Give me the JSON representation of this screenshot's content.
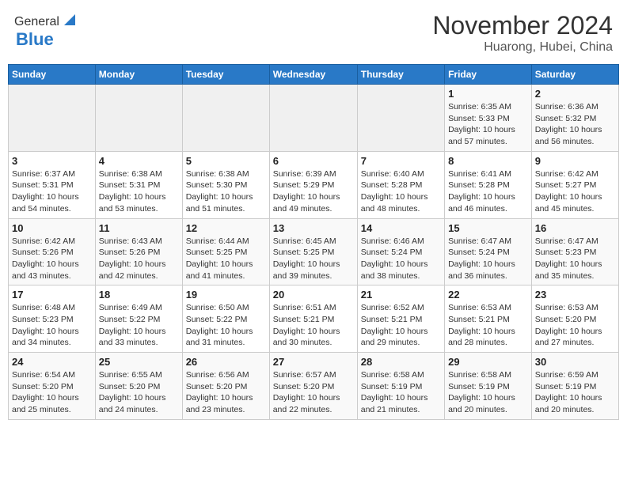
{
  "header": {
    "logo_general": "General",
    "logo_blue": "Blue",
    "title": "November 2024",
    "subtitle": "Huarong, Hubei, China"
  },
  "days_of_week": [
    "Sunday",
    "Monday",
    "Tuesday",
    "Wednesday",
    "Thursday",
    "Friday",
    "Saturday"
  ],
  "weeks": [
    [
      {
        "day": "",
        "info": ""
      },
      {
        "day": "",
        "info": ""
      },
      {
        "day": "",
        "info": ""
      },
      {
        "day": "",
        "info": ""
      },
      {
        "day": "",
        "info": ""
      },
      {
        "day": "1",
        "info": "Sunrise: 6:35 AM\nSunset: 5:33 PM\nDaylight: 10 hours\nand 57 minutes."
      },
      {
        "day": "2",
        "info": "Sunrise: 6:36 AM\nSunset: 5:32 PM\nDaylight: 10 hours\nand 56 minutes."
      }
    ],
    [
      {
        "day": "3",
        "info": "Sunrise: 6:37 AM\nSunset: 5:31 PM\nDaylight: 10 hours\nand 54 minutes."
      },
      {
        "day": "4",
        "info": "Sunrise: 6:38 AM\nSunset: 5:31 PM\nDaylight: 10 hours\nand 53 minutes."
      },
      {
        "day": "5",
        "info": "Sunrise: 6:38 AM\nSunset: 5:30 PM\nDaylight: 10 hours\nand 51 minutes."
      },
      {
        "day": "6",
        "info": "Sunrise: 6:39 AM\nSunset: 5:29 PM\nDaylight: 10 hours\nand 49 minutes."
      },
      {
        "day": "7",
        "info": "Sunrise: 6:40 AM\nSunset: 5:28 PM\nDaylight: 10 hours\nand 48 minutes."
      },
      {
        "day": "8",
        "info": "Sunrise: 6:41 AM\nSunset: 5:28 PM\nDaylight: 10 hours\nand 46 minutes."
      },
      {
        "day": "9",
        "info": "Sunrise: 6:42 AM\nSunset: 5:27 PM\nDaylight: 10 hours\nand 45 minutes."
      }
    ],
    [
      {
        "day": "10",
        "info": "Sunrise: 6:42 AM\nSunset: 5:26 PM\nDaylight: 10 hours\nand 43 minutes."
      },
      {
        "day": "11",
        "info": "Sunrise: 6:43 AM\nSunset: 5:26 PM\nDaylight: 10 hours\nand 42 minutes."
      },
      {
        "day": "12",
        "info": "Sunrise: 6:44 AM\nSunset: 5:25 PM\nDaylight: 10 hours\nand 41 minutes."
      },
      {
        "day": "13",
        "info": "Sunrise: 6:45 AM\nSunset: 5:25 PM\nDaylight: 10 hours\nand 39 minutes."
      },
      {
        "day": "14",
        "info": "Sunrise: 6:46 AM\nSunset: 5:24 PM\nDaylight: 10 hours\nand 38 minutes."
      },
      {
        "day": "15",
        "info": "Sunrise: 6:47 AM\nSunset: 5:24 PM\nDaylight: 10 hours\nand 36 minutes."
      },
      {
        "day": "16",
        "info": "Sunrise: 6:47 AM\nSunset: 5:23 PM\nDaylight: 10 hours\nand 35 minutes."
      }
    ],
    [
      {
        "day": "17",
        "info": "Sunrise: 6:48 AM\nSunset: 5:23 PM\nDaylight: 10 hours\nand 34 minutes."
      },
      {
        "day": "18",
        "info": "Sunrise: 6:49 AM\nSunset: 5:22 PM\nDaylight: 10 hours\nand 33 minutes."
      },
      {
        "day": "19",
        "info": "Sunrise: 6:50 AM\nSunset: 5:22 PM\nDaylight: 10 hours\nand 31 minutes."
      },
      {
        "day": "20",
        "info": "Sunrise: 6:51 AM\nSunset: 5:21 PM\nDaylight: 10 hours\nand 30 minutes."
      },
      {
        "day": "21",
        "info": "Sunrise: 6:52 AM\nSunset: 5:21 PM\nDaylight: 10 hours\nand 29 minutes."
      },
      {
        "day": "22",
        "info": "Sunrise: 6:53 AM\nSunset: 5:21 PM\nDaylight: 10 hours\nand 28 minutes."
      },
      {
        "day": "23",
        "info": "Sunrise: 6:53 AM\nSunset: 5:20 PM\nDaylight: 10 hours\nand 27 minutes."
      }
    ],
    [
      {
        "day": "24",
        "info": "Sunrise: 6:54 AM\nSunset: 5:20 PM\nDaylight: 10 hours\nand 25 minutes."
      },
      {
        "day": "25",
        "info": "Sunrise: 6:55 AM\nSunset: 5:20 PM\nDaylight: 10 hours\nand 24 minutes."
      },
      {
        "day": "26",
        "info": "Sunrise: 6:56 AM\nSunset: 5:20 PM\nDaylight: 10 hours\nand 23 minutes."
      },
      {
        "day": "27",
        "info": "Sunrise: 6:57 AM\nSunset: 5:20 PM\nDaylight: 10 hours\nand 22 minutes."
      },
      {
        "day": "28",
        "info": "Sunrise: 6:58 AM\nSunset: 5:19 PM\nDaylight: 10 hours\nand 21 minutes."
      },
      {
        "day": "29",
        "info": "Sunrise: 6:58 AM\nSunset: 5:19 PM\nDaylight: 10 hours\nand 20 minutes."
      },
      {
        "day": "30",
        "info": "Sunrise: 6:59 AM\nSunset: 5:19 PM\nDaylight: 10 hours\nand 20 minutes."
      }
    ]
  ]
}
